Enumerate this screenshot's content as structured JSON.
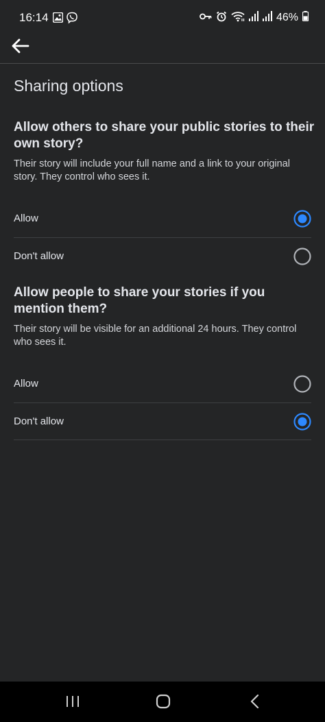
{
  "status_bar": {
    "time": "16:14",
    "battery": "46%",
    "icons": [
      "gallery-icon",
      "viber-icon",
      "key-icon",
      "alarm-icon",
      "wifi-icon",
      "signal-icon",
      "signal-icon",
      "battery-icon"
    ]
  },
  "header": {
    "back_icon": "arrow-left-icon"
  },
  "page": {
    "title": "Sharing options"
  },
  "sections": [
    {
      "heading": "Allow others to share your public stories to their own story?",
      "description": "Their story will include your full name and a link to your original story. They control who sees it.",
      "options": [
        {
          "label": "Allow",
          "selected": true
        },
        {
          "label": "Don't allow",
          "selected": false
        }
      ]
    },
    {
      "heading": "Allow people to share your stories if you mention them?",
      "description": "Their story will be visible for an additional 24 hours. They control who sees it.",
      "options": [
        {
          "label": "Allow",
          "selected": false
        },
        {
          "label": "Don't allow",
          "selected": true
        }
      ]
    }
  ],
  "nav_bar": {
    "buttons": [
      "recent-apps-icon",
      "home-icon",
      "back-nav-icon"
    ]
  },
  "colors": {
    "background": "#242526",
    "accent": "#2d88ff",
    "text": "#e4e6eb"
  }
}
